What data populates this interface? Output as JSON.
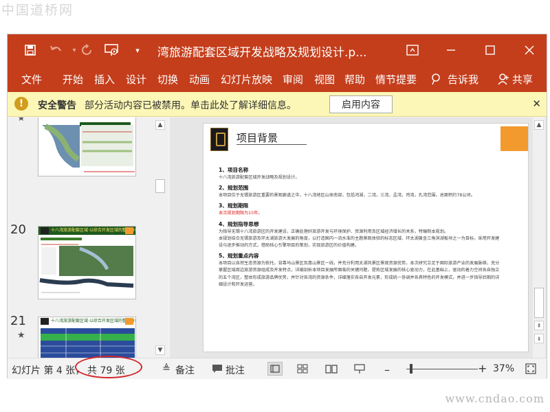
{
  "watermark_top": "中国道桥网",
  "watermark_bottom": "www.cndao.com",
  "titlebar": {
    "title": "湾旅游配套区域开发战略及规划设计.p...",
    "save_icon": "save-icon",
    "undo_icon": "undo-icon",
    "redo_icon": "redo-icon",
    "present_icon": "present-from-start-icon",
    "customize_icon": "customize-qat-icon"
  },
  "ribbon": {
    "tabs": [
      "文件",
      "开始",
      "插入",
      "设计",
      "切换",
      "动画",
      "幻灯片放映",
      "审阅",
      "视图",
      "帮助",
      "情节提要"
    ],
    "tell_me": "告诉我",
    "share": "共享"
  },
  "security": {
    "title": "安全警告",
    "message": "部分活动内容已被禁用。单击此处了解详细信息。",
    "button": "启用内容"
  },
  "thumbnails": [
    {
      "number": "",
      "banner": ""
    },
    {
      "number": "20",
      "banner": "十八湾旅游配套区域·以综合开发区域的整体分析"
    },
    {
      "number": "21",
      "banner": "十八湾旅游配套区域·以综合开发区域的整体分析"
    }
  ],
  "slide": {
    "title": "项目背景",
    "sections": [
      {
        "heading": "1、项目名称",
        "lines": [
          "十八湾旅游配套区域开发战略及规划设计。"
        ]
      },
      {
        "heading": "2、规划范围",
        "lines": [
          "本项目位于无锡旅游区重要的景观廊道之中，十八湾地区山体南部，包括鸿湖，二湾，三湾，孟湾，鸡湾，孔湾范围，总面积约78公顷。"
        ]
      },
      {
        "heading": "3、规划期限",
        "lines": [
          "本次规划期限为15年。"
        ],
        "red": true
      },
      {
        "heading": "4、规划指导思想",
        "lines": [
          "为指导无锡十八湾旅游区的开发建设，正确处理好旅游开发与环境保护、资源利用及区域经济增长的关系，特编制本规划。",
          "本规划结合无锡旅游及环太湖旅游大发展的角度，以打造国内一流水准的主题景观体验的标志区域、环太湖黄金三角滨湖板块之一为目标，采用开发建设与逐步推动的方式，借助核心引擎项目的策划，实现旅游区的价值构建。"
        ]
      },
      {
        "heading": "5、规划重点内容",
        "lines": [
          "本项目以自然生态资源为依托，背靠马山景区及惠山景区一线，并充分利用太湖风景区景观资源优势，本次研究立足于国际旅游产业的发展脉络，充分掌握区域周边旅游资源组成及开发特点，详细剖析本项目发展所面临的关键问题，提炼区域发展的核心驱动力，在此基础上，驱动的着力空间各自独立的五个湾区，整体形成旅游品牌优势，并针对各湾的资源条件，详细落实各自开发元素，形成统一协调并各具特色的开发模式，并进一步指导后期的详细设计和开发运营。"
        ]
      }
    ]
  },
  "status": {
    "slide_info_prefix": "幻灯片 第 4 张，",
    "slide_info_total": "共 79 张",
    "notes": "备注",
    "comments": "批注",
    "zoom": "37%"
  }
}
